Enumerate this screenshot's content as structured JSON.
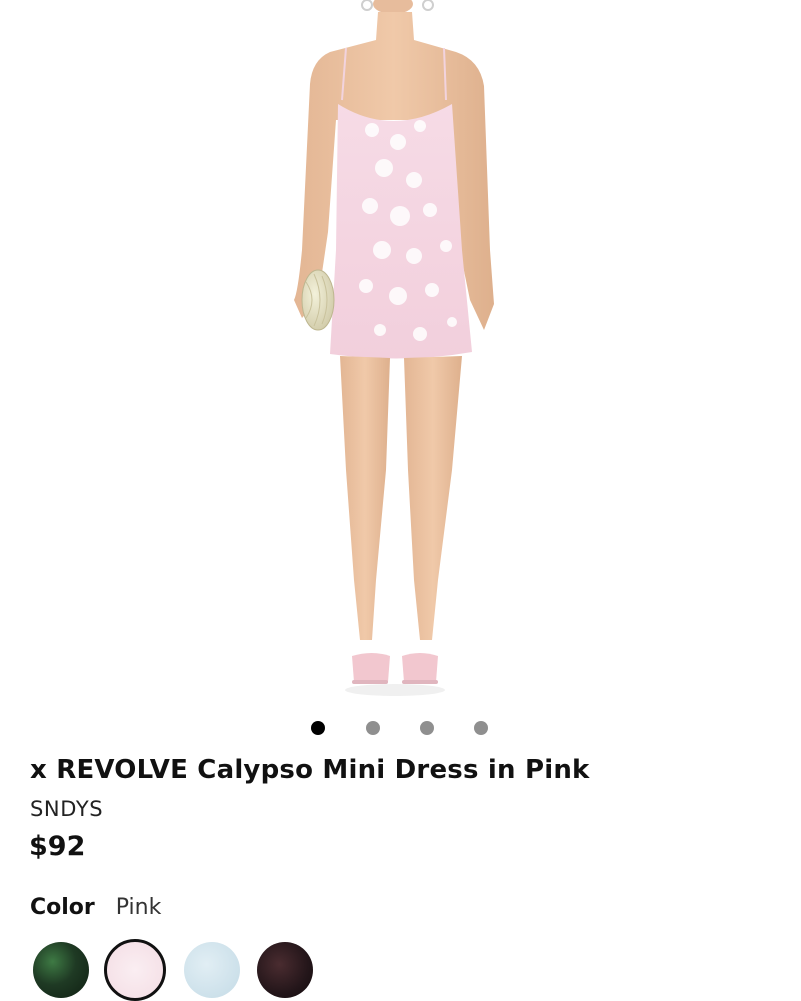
{
  "product": {
    "title": "x REVOLVE Calypso Mini Dress in Pink",
    "brand": "SNDYS",
    "price": "$92"
  },
  "gallery": {
    "image_count": 4,
    "active_index": 0
  },
  "color": {
    "label": "Color",
    "selected": "Pink",
    "swatches": [
      {
        "name": "green-pattern-swatch",
        "color": "#1f3a24",
        "selected": false
      },
      {
        "name": "pink-swatch",
        "color": "#f7e3e8",
        "selected": true
      },
      {
        "name": "light-blue-swatch",
        "color": "#cfe2ec",
        "selected": false
      },
      {
        "name": "dark-swatch",
        "color": "#2a1a1c",
        "selected": false
      }
    ]
  }
}
